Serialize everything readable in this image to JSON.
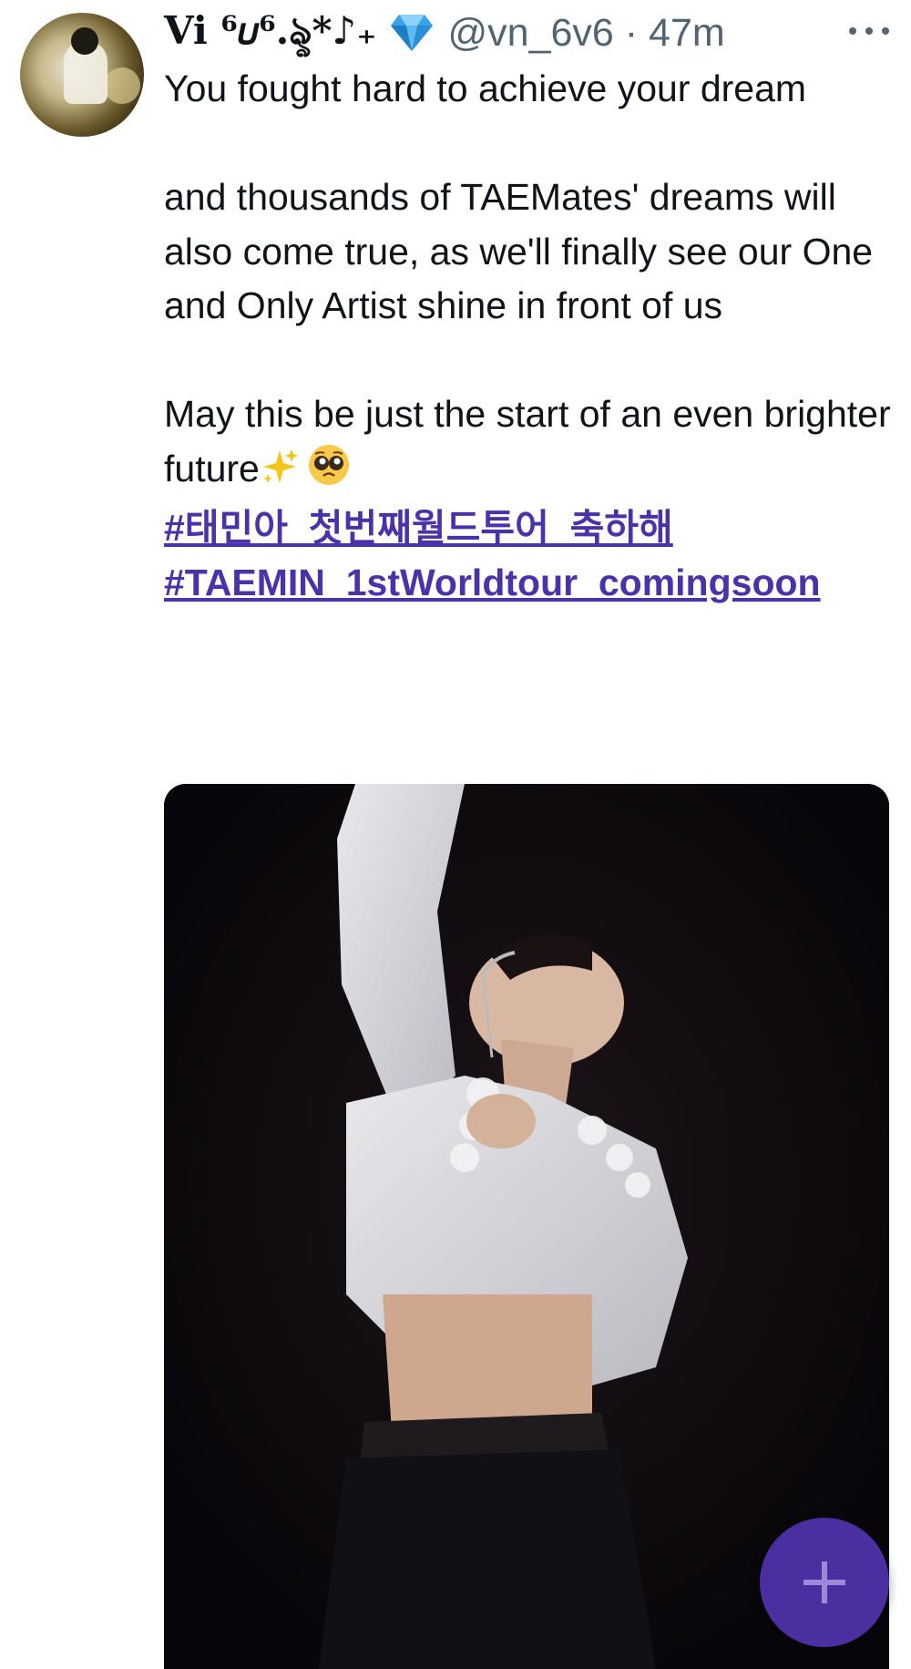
{
  "tweet": {
    "display_name": "Vi ⁶𝜐⁶.ৡ*♪₊",
    "handle": "@vn_6v6",
    "separator": "·",
    "time": "47m",
    "paragraphs": [
      "You fought hard to achieve your dream",
      "and thousands of TAEMates' dreams will also come true, as we'll finally see our One and Only Artist shine in front of us",
      "May this be just the start of an even brighter future"
    ],
    "hashtags": [
      "#태민아_첫번째월드투어_축하해",
      "#TAEMIN_1stWorldtour_comingsoon"
    ],
    "media": {
      "description_icon": "performer-photo"
    }
  },
  "ui": {
    "more_icon": "more-options-icon",
    "fab_icon": "plus-icon",
    "accent_color": "#4b2fa0",
    "link_color": "#4a33a8",
    "meta_color": "#536471"
  }
}
